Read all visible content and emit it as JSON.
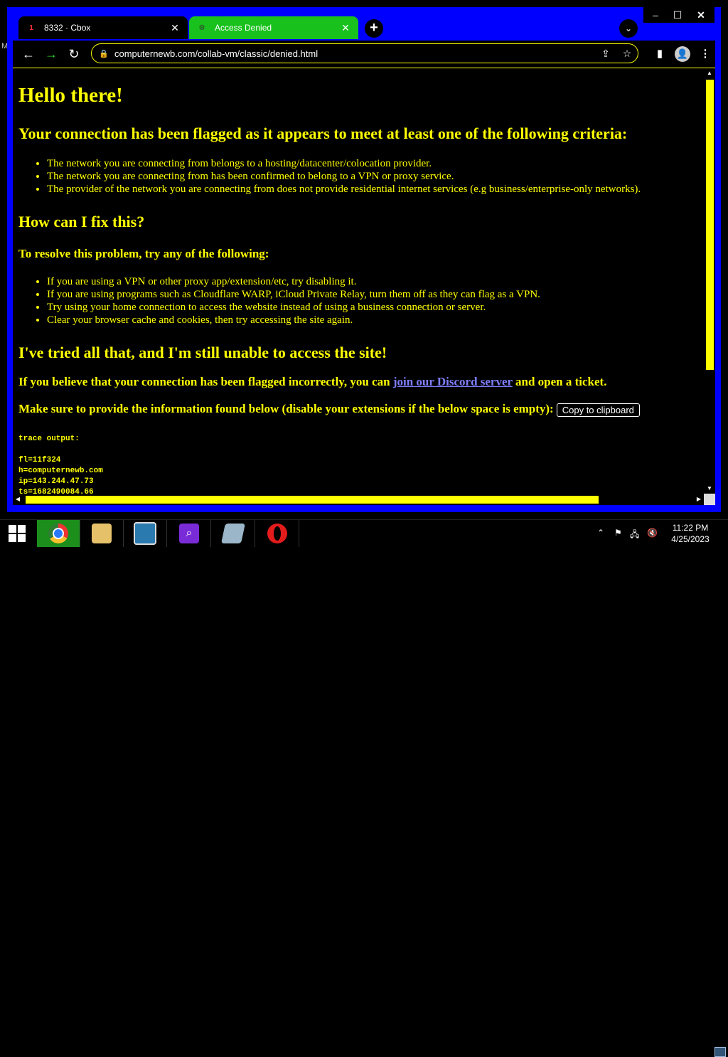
{
  "desktop": {
    "left_label": "M"
  },
  "window_controls": {
    "minimize": "‒",
    "maximize": "☐",
    "close": "✕"
  },
  "tabs": [
    {
      "favicon": "1",
      "title": "8332 · Cbox",
      "close": "✕"
    },
    {
      "favicon": "⚙",
      "title": "Access Denied",
      "close": "✕"
    }
  ],
  "new_tab": "+",
  "tab_search": "⌄",
  "toolbar": {
    "back": "←",
    "forward": "→",
    "reload": "↻",
    "lock": "🔒",
    "url": "computernewb.com/collab-vm/classic/denied.html",
    "share": "⇪",
    "star": "☆",
    "side_panel": "▮",
    "profile": "👤",
    "menu": "⋮"
  },
  "page": {
    "h1": "Hello there!",
    "h2_criteria": "Your connection has been flagged as it appears to meet at least one of the following criteria:",
    "criteria": [
      "The network you are connecting from belongs to a hosting/datacenter/colocation provider.",
      "The network you are connecting from has been confirmed to belong to a VPN or proxy service.",
      "The provider of the network you are connecting from does not provide residential internet services (e.g business/enterprise-only networks)."
    ],
    "h2_fix": "How can I fix this?",
    "h3_resolve": "To resolve this problem, try any of the following:",
    "fixes": [
      "If you are using a VPN or other proxy app/extension/etc, try disabling it.",
      "If you are using programs such as Cloudflare WARP, iCloud Private Relay, turn them off as they can flag as a VPN.",
      "Try using your home connection to access the website instead of using a business connection or server.",
      "Clear your browser cache and cookies, then try accessing the site again."
    ],
    "h2_tried": "I've tried all that, and I'm still unable to access the site!",
    "discord_pre": "If you believe that your connection has been flagged incorrectly, you can ",
    "discord_link": "join our Discord server",
    "discord_post": " and open a ticket.",
    "provide_info": "Make sure to provide the information found below (disable your extensions if the below space is empty):",
    "copy_button": "Copy to clipboard",
    "trace": "trace output:\n\nfl=11f324\nh=computernewb.com\nip=143.244.47.73\nts=1682490084.66"
  },
  "scrollbars": {
    "up": "▲",
    "down": "▼",
    "left": "◀",
    "right": "▶",
    "vertical_position": 0.0,
    "horizontal_position": 0.0
  },
  "taskbar": {
    "apps": [
      "chrome-icon",
      "file-explorer-icon",
      "photos-icon",
      "magnifier-icon",
      "notebook-icon",
      "opera-icon"
    ],
    "tray": {
      "chevron": "⌃",
      "flag": "⚑",
      "network": "🖧",
      "volume": "🔇"
    },
    "time": "11:22 PM",
    "date": "4/25/2023"
  },
  "colors": {
    "window_border": "#0000ff",
    "text": "#ffff00",
    "link": "#7f7fff",
    "active_tab": "#19c11d",
    "chrome_taskbar_active": "#1b8e1b"
  }
}
